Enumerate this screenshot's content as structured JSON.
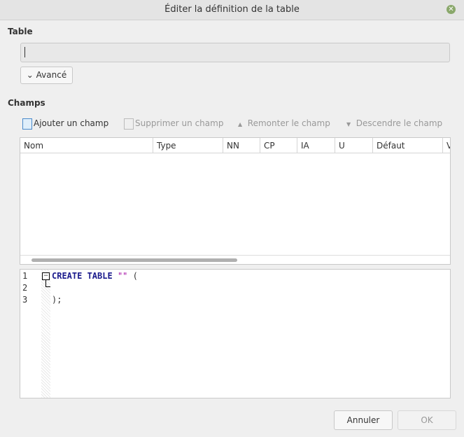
{
  "window": {
    "title": "Éditer la définition de la table"
  },
  "table": {
    "label": "Table",
    "value": "",
    "advanced_label": "Avancé"
  },
  "fields": {
    "label": "Champs",
    "toolbar": {
      "add": "Ajouter un champ",
      "remove": "Supprimer un champ",
      "up": "Remonter le champ",
      "down": "Descendre le champ"
    },
    "columns": [
      "Nom",
      "Type",
      "NN",
      "CP",
      "IA",
      "U",
      "Défaut",
      "V"
    ]
  },
  "sql": {
    "line_numbers": [
      "1",
      "2",
      "3"
    ],
    "keyword": "CREATE TABLE",
    "string": "\"\"",
    "open": "(",
    "close": ");"
  },
  "buttons": {
    "cancel": "Annuler",
    "ok": "OK"
  }
}
